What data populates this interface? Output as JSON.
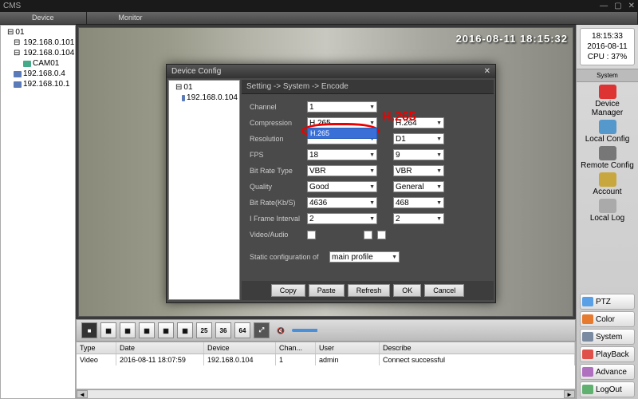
{
  "app_title": "CMS",
  "tabs": [
    "Device",
    "Monitor"
  ],
  "tree": {
    "root": "01",
    "items": [
      "192.168.0.101",
      "192.168.0.104",
      "CAM01",
      "192.168.0.4",
      "192.168.10.1"
    ]
  },
  "overlay_timestamp": "2016-08-11 18:15:32",
  "status": {
    "time": "18:15:33",
    "date": "2016-08-11",
    "cpu": "CPU : 37%"
  },
  "side_section": "System",
  "side_items": [
    "Device Manager",
    "Local Config",
    "Remote Config",
    "Account",
    "Local Log"
  ],
  "side_icon_colors": [
    "#d33",
    "#59c",
    "#777",
    "#c8a83e",
    "#aaa"
  ],
  "right_buttons": [
    {
      "label": "PTZ",
      "color": "#5aa0e6"
    },
    {
      "label": "Color",
      "color": "#e67a2e"
    },
    {
      "label": "System",
      "color": "#7a8aa0"
    },
    {
      "label": "PlayBack",
      "color": "#e0504a"
    },
    {
      "label": "Advance",
      "color": "#b070c0"
    },
    {
      "label": "LogOut",
      "color": "#60b070"
    }
  ],
  "toolbar_labels": [
    "1",
    "4",
    "6",
    "8",
    "9",
    "16",
    "25",
    "36",
    "64"
  ],
  "log": {
    "headers": [
      "Type",
      "Date",
      "Device",
      "Chan...",
      "User",
      "Describe"
    ],
    "row": [
      "Video",
      "2016-08-11 18:07:59",
      "192.168.0.104",
      "1",
      "admin",
      "Connect successful"
    ]
  },
  "modal": {
    "title": "Device Config",
    "tree_root": "01",
    "tree_item": "192.168.0.104",
    "breadcrumb": "Setting -> System -> Encode",
    "annotation": "H.265",
    "dropdown_open_value": "H.265",
    "fields": [
      {
        "label": "Channel",
        "v1": "1",
        "v2": ""
      },
      {
        "label": "Compression",
        "v1": "H.265",
        "v2": "H.264"
      },
      {
        "label": "Resolution",
        "v1": "",
        "v2": "D1"
      },
      {
        "label": "FPS",
        "v1": "18",
        "v2": "9"
      },
      {
        "label": "Bit Rate Type",
        "v1": "VBR",
        "v2": "VBR"
      },
      {
        "label": "Quality",
        "v1": "Good",
        "v2": "General"
      },
      {
        "label": "Bit Rate(Kb/S)",
        "v1": "4636",
        "v2": "468"
      },
      {
        "label": "I Frame Interval",
        "v1": "2",
        "v2": "2"
      },
      {
        "label": "Video/Audio",
        "v1": "",
        "v2": ""
      }
    ],
    "static_label": "Static configuration of",
    "static_value": "main profile",
    "buttons": [
      "Copy",
      "Paste",
      "Refresh",
      "OK",
      "Cancel"
    ]
  }
}
